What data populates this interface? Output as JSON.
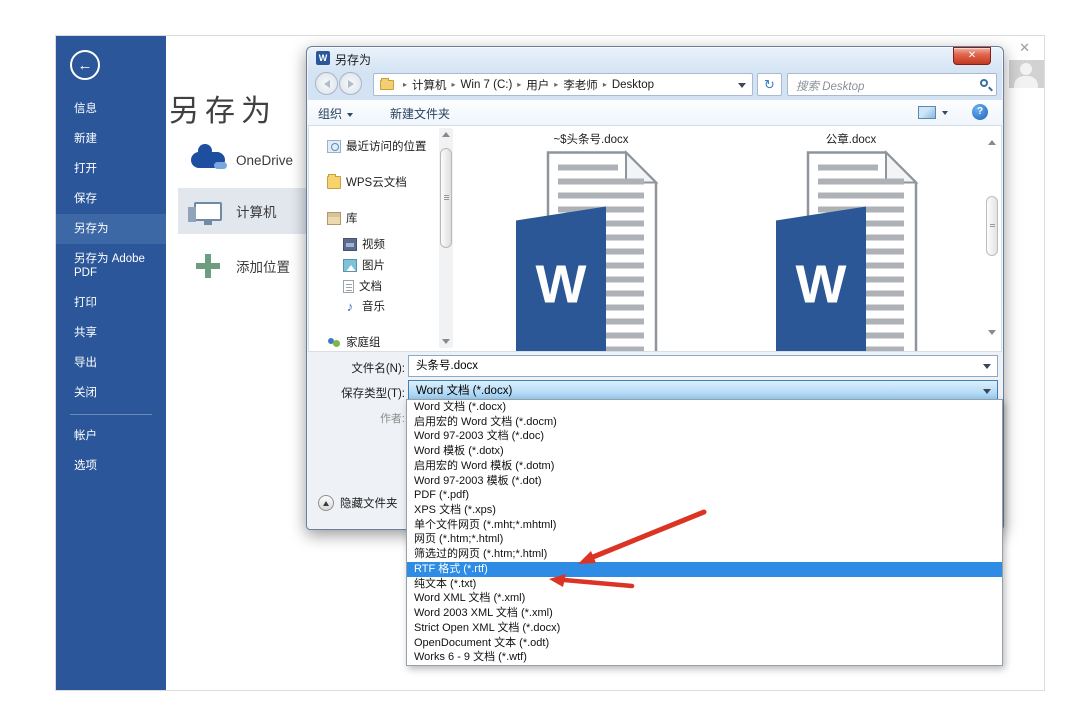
{
  "icons": {
    "back_arrow": "←",
    "close": "✕",
    "crumb_separator": "▸",
    "word_logo_letter": "W",
    "help": "?",
    "refresh": "↻",
    "music_note": "♪"
  },
  "backstage": {
    "sidebar": {
      "color": "#2b579a",
      "items": [
        "信息",
        "新建",
        "打开",
        "保存",
        "另存为",
        "另存为 Adobe PDF",
        "打印",
        "共享",
        "导出",
        "关闭",
        "帐户",
        "选项"
      ],
      "selected": "另存为"
    },
    "title": "另存为",
    "places": {
      "onedrive": "OneDrive",
      "computer": "计算机",
      "add_place": "添加位置",
      "selected": "计算机"
    }
  },
  "dialog": {
    "title": "另存为",
    "breadcrumb": [
      "计算机",
      "Win 7 (C:)",
      "用户",
      "李老师",
      "Desktop"
    ],
    "search_placeholder": "搜索 Desktop",
    "toolbar": {
      "organize": "组织",
      "new_folder": "新建文件夹"
    },
    "nav_items": [
      "最近访问的位置",
      "WPS云文档",
      "库",
      "视频",
      "图片",
      "文档",
      "音乐",
      "家庭组"
    ],
    "files": [
      "~$头条号.docx",
      "公章.docx"
    ],
    "filename_label": "文件名(N):",
    "filename_value": "头条号.docx",
    "savetype_label": "保存类型(T):",
    "savetype_value": "Word 文档 (*.docx)",
    "author_label": "作者:",
    "hide_folders_label": "隐藏文件夹",
    "filetype_dropdown": {
      "selection_color": "#2f8ce4",
      "selected": "RTF 格式 (*.rtf)",
      "items": [
        "Word 文档 (*.docx)",
        "启用宏的 Word 文档 (*.docm)",
        "Word 97-2003 文档 (*.doc)",
        "Word 模板 (*.dotx)",
        "启用宏的 Word 模板 (*.dotm)",
        "Word 97-2003 模板 (*.dot)",
        "PDF (*.pdf)",
        "XPS 文档 (*.xps)",
        "单个文件网页 (*.mht;*.mhtml)",
        "网页 (*.htm;*.html)",
        "筛选过的网页 (*.htm;*.html)",
        "RTF 格式 (*.rtf)",
        "纯文本 (*.txt)",
        "Word XML 文档 (*.xml)",
        "Word 2003 XML 文档 (*.xml)",
        "Strict Open XML 文档 (*.docx)",
        "OpenDocument 文本 (*.odt)",
        "Works 6 - 9 文档 (*.wtf)"
      ]
    }
  },
  "annotations": {
    "arrow_color": "#dc3424",
    "arrow_targets": [
      "RTF 格式 (*.rtf)",
      "纯文本 (*.txt)"
    ]
  }
}
